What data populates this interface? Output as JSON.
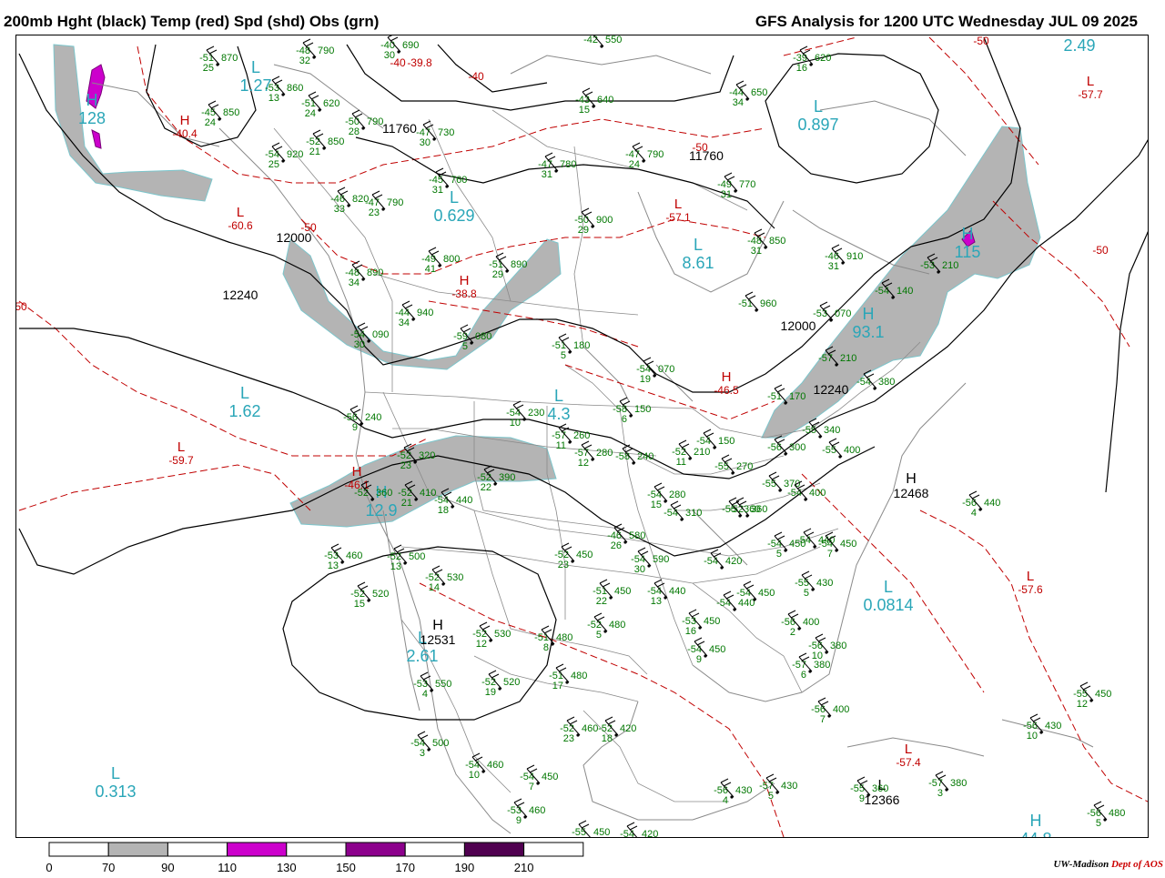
{
  "header": {
    "title_left": "200mb Hght (black) Temp (red) Spd (shd) Obs (grn)",
    "title_right": "GFS Analysis for 1200 UTC Wednesday  JUL 09 2025"
  },
  "credit": {
    "org": "UW-Madison",
    "dept": "Dept of AOS"
  },
  "colors": {
    "height_contour": "#000000",
    "temp_contour": "#c00000",
    "speed_70_90": "#b4b4b4",
    "speed_110_130": "#cc00cc",
    "speed_150_170": "#8c008c",
    "speed_190_210": "#500050",
    "obs": "#007700",
    "center_labels": "#2aa6b8",
    "political_lines": "#8a8a8a"
  },
  "legend": {
    "ticks": [
      "0",
      "70",
      "90",
      "110",
      "130",
      "150",
      "170",
      "190",
      "210"
    ],
    "fills": [
      "#ffffff",
      "#b4b4b4",
      "#ffffff",
      "#cc00cc",
      "#ffffff",
      "#8c008c",
      "#ffffff",
      "#500050",
      "#ffffff"
    ]
  },
  "height_labels": [
    "12000",
    "12240",
    "12000",
    "12240",
    "12468",
    "12531",
    "12366",
    "11760",
    "11760",
    "11760"
  ],
  "temp_labels": [
    "-40",
    "-40",
    "-50",
    "-50",
    "-50",
    "-60.6",
    "-40.4",
    "-38.8",
    "-39.8",
    "-46.5",
    "-46.1",
    "-59.7",
    "-57.6",
    "-57.4",
    "-57.1",
    "-57.7",
    "-50",
    "-50",
    "-50"
  ],
  "centers": [
    {
      "letter": "H",
      "color": "red",
      "value": "-40.4"
    },
    {
      "letter": "H",
      "color": "red",
      "value": "-38.8"
    },
    {
      "letter": "H",
      "color": "red",
      "value": "-46.5"
    },
    {
      "letter": "H",
      "color": "red",
      "value": "-46.1"
    },
    {
      "letter": "L",
      "color": "red",
      "value": "-60.6"
    },
    {
      "letter": "L",
      "color": "red",
      "value": "-59.7"
    },
    {
      "letter": "L",
      "color": "red",
      "value": "-57.6"
    },
    {
      "letter": "L",
      "color": "red",
      "value": "-57.4"
    },
    {
      "letter": "L",
      "color": "red",
      "value": "-57.1"
    },
    {
      "letter": "L",
      "color": "red",
      "value": "-57.7"
    },
    {
      "letter": "L",
      "color": "cyan",
      "value": "1.27"
    },
    {
      "letter": "L",
      "color": "cyan",
      "value": "0.629"
    },
    {
      "letter": "L",
      "color": "cyan",
      "value": "8.61"
    },
    {
      "letter": "L",
      "color": "cyan",
      "value": "0.897"
    },
    {
      "letter": "L",
      "color": "cyan",
      "value": "1.62"
    },
    {
      "letter": "L",
      "color": "cyan",
      "value": "2.61"
    },
    {
      "letter": "L",
      "color": "cyan",
      "value": "0.313"
    },
    {
      "letter": "L",
      "color": "cyan",
      "value": "0.0814"
    },
    {
      "letter": "H",
      "color": "cyan",
      "value": "2.49"
    },
    {
      "letter": "H",
      "color": "cyan",
      "value": "93.1"
    },
    {
      "letter": "H",
      "color": "cyan",
      "value": "115"
    },
    {
      "letter": "H",
      "color": "cyan",
      "value": "44.8"
    },
    {
      "letter": "H",
      "color": "cyan",
      "value": "12.9"
    },
    {
      "letter": "L",
      "color": "cyan",
      "value": "4.3"
    },
    {
      "letter": "H",
      "color": "cyan",
      "value": "128"
    },
    {
      "letter": "H",
      "color": "black",
      "value": "12468"
    },
    {
      "letter": "H",
      "color": "black",
      "value": "12531"
    },
    {
      "letter": "L",
      "color": "black",
      "value": "12366"
    }
  ],
  "obs": [
    {
      "t": "-51",
      "d": "25",
      "h": "870"
    },
    {
      "t": "-48",
      "d": "32",
      "h": "790"
    },
    {
      "t": "-40",
      "d": "30",
      "h": "690"
    },
    {
      "t": "-42",
      "d": "",
      "h": "550"
    },
    {
      "t": "-45",
      "d": "24",
      "h": "850"
    },
    {
      "t": "-53",
      "d": "13",
      "h": "860"
    },
    {
      "t": "-51",
      "d": "24",
      "h": "620"
    },
    {
      "t": "-50",
      "d": "28",
      "h": "790"
    },
    {
      "t": "-52",
      "d": "21",
      "h": "850"
    },
    {
      "t": "-54",
      "d": "25",
      "h": "920"
    },
    {
      "t": "-47",
      "d": "30",
      "h": "730"
    },
    {
      "t": "-44",
      "d": "34",
      "h": "650"
    },
    {
      "t": "-39",
      "d": "16",
      "h": "620"
    },
    {
      "t": "-43",
      "d": "15",
      "h": "640"
    },
    {
      "t": "-47",
      "d": "24",
      "h": "790"
    },
    {
      "t": "-47",
      "d": "31",
      "h": "780"
    },
    {
      "t": "-49",
      "d": "31",
      "h": "770"
    },
    {
      "t": "-45",
      "d": "31",
      "h": "760"
    },
    {
      "t": "-46",
      "d": "33",
      "h": "820"
    },
    {
      "t": "-47",
      "d": "23",
      "h": "790"
    },
    {
      "t": "-50",
      "d": "29",
      "h": "900"
    },
    {
      "t": "-48",
      "d": "31",
      "h": "850"
    },
    {
      "t": "-46",
      "d": "31",
      "h": "910"
    },
    {
      "t": "-49",
      "d": "41",
      "h": "800"
    },
    {
      "t": "-51",
      "d": "29",
      "h": "890"
    },
    {
      "t": "-48",
      "d": "34",
      "h": "890"
    },
    {
      "t": "-53",
      "d": "",
      "h": "210"
    },
    {
      "t": "-54",
      "d": "",
      "h": "140"
    },
    {
      "t": "-51",
      "d": "",
      "h": "960"
    },
    {
      "t": "-53",
      "d": "",
      "h": "070"
    },
    {
      "t": "-44",
      "d": "34",
      "h": "940"
    },
    {
      "t": "-54",
      "d": "30",
      "h": "090"
    },
    {
      "t": "-59",
      "d": "5",
      "h": "080"
    },
    {
      "t": "-51",
      "d": "5",
      "h": "180"
    },
    {
      "t": "-54",
      "d": "19",
      "h": "070"
    },
    {
      "t": "-57",
      "d": "",
      "h": "210"
    },
    {
      "t": "-54",
      "d": "",
      "h": "380"
    },
    {
      "t": "-51",
      "d": "",
      "h": "170"
    },
    {
      "t": "-56",
      "d": "9",
      "h": "240"
    },
    {
      "t": "-54",
      "d": "10",
      "h": "230"
    },
    {
      "t": "-58",
      "d": "6",
      "h": "150"
    },
    {
      "t": "-57",
      "d": "11",
      "h": "260"
    },
    {
      "t": "-55",
      "d": "",
      "h": "340"
    },
    {
      "t": "-52",
      "d": "23",
      "h": "320"
    },
    {
      "t": "-52",
      "d": "22",
      "h": "390"
    },
    {
      "t": "-57",
      "d": "12",
      "h": "280"
    },
    {
      "t": "-58",
      "d": "",
      "h": "240"
    },
    {
      "t": "-52",
      "d": "11",
      "h": "210"
    },
    {
      "t": "-54",
      "d": "",
      "h": "150"
    },
    {
      "t": "-55",
      "d": "",
      "h": "270"
    },
    {
      "t": "-56",
      "d": "",
      "h": "300"
    },
    {
      "t": "-55",
      "d": "",
      "h": "400"
    },
    {
      "t": "-52",
      "d": "",
      "h": "360"
    },
    {
      "t": "-52",
      "d": "21",
      "h": "410"
    },
    {
      "t": "-54",
      "d": "18",
      "h": "440"
    },
    {
      "t": "-55",
      "d": "",
      "h": "370"
    },
    {
      "t": "-54",
      "d": "",
      "h": "400"
    },
    {
      "t": "-52",
      "d": "",
      "h": "360"
    },
    {
      "t": "-54",
      "d": "15",
      "h": "280"
    },
    {
      "t": "-54",
      "d": "",
      "h": "310"
    },
    {
      "t": "-55",
      "d": "",
      "h": "360"
    },
    {
      "t": "-56",
      "d": "4",
      "h": "440"
    },
    {
      "t": "-46",
      "d": "26",
      "h": "580"
    },
    {
      "t": "-54",
      "d": "",
      "h": "440"
    },
    {
      "t": "-53",
      "d": "13",
      "h": "460"
    },
    {
      "t": "-52",
      "d": "13",
      "h": "500"
    },
    {
      "t": "-52",
      "d": "23",
      "h": "450"
    },
    {
      "t": "-54",
      "d": "30",
      "h": "590"
    },
    {
      "t": "-54",
      "d": "",
      "h": "420"
    },
    {
      "t": "-54",
      "d": "5",
      "h": "450"
    },
    {
      "t": "-54",
      "d": "7",
      "h": "450"
    },
    {
      "t": "-52",
      "d": "14",
      "h": "530"
    },
    {
      "t": "-52",
      "d": "15",
      "h": "520"
    },
    {
      "t": "-51",
      "d": "22",
      "h": "450"
    },
    {
      "t": "-54",
      "d": "13",
      "h": "440"
    },
    {
      "t": "-54",
      "d": "",
      "h": "440"
    },
    {
      "t": "-54",
      "d": "",
      "h": "450"
    },
    {
      "t": "-55",
      "d": "5",
      "h": "430"
    },
    {
      "t": "-52",
      "d": "12",
      "h": "530"
    },
    {
      "t": "-51",
      "d": "8",
      "h": "480"
    },
    {
      "t": "-52",
      "d": "5",
      "h": "480"
    },
    {
      "t": "-53",
      "d": "16",
      "h": "450"
    },
    {
      "t": "-56",
      "d": "2",
      "h": "400"
    },
    {
      "t": "-56",
      "d": "10",
      "h": "380"
    },
    {
      "t": "-54",
      "d": "9",
      "h": "450"
    },
    {
      "t": "-57",
      "d": "6",
      "h": "380"
    },
    {
      "t": "-53",
      "d": "4",
      "h": "550"
    },
    {
      "t": "-52",
      "d": "19",
      "h": "520"
    },
    {
      "t": "-51",
      "d": "17",
      "h": "480"
    },
    {
      "t": "-56",
      "d": "7",
      "h": "400"
    },
    {
      "t": "-52",
      "d": "23",
      "h": "460"
    },
    {
      "t": "-52",
      "d": "18",
      "h": "420"
    },
    {
      "t": "-55",
      "d": "12",
      "h": "450"
    },
    {
      "t": "-56",
      "d": "10",
      "h": "430"
    },
    {
      "t": "-54",
      "d": "3",
      "h": "500"
    },
    {
      "t": "-54",
      "d": "10",
      "h": "460"
    },
    {
      "t": "-54",
      "d": "7",
      "h": "450"
    },
    {
      "t": "-56",
      "d": "4",
      "h": "430"
    },
    {
      "t": "-57",
      "d": "5",
      "h": "430"
    },
    {
      "t": "-55",
      "d": "9",
      "h": "360"
    },
    {
      "t": "-57",
      "d": "3",
      "h": "380"
    },
    {
      "t": "-53",
      "d": "9",
      "h": "460"
    },
    {
      "t": "-55",
      "d": "",
      "h": "450"
    },
    {
      "t": "-54",
      "d": "",
      "h": "420"
    },
    {
      "t": "-56",
      "d": "5",
      "h": "480"
    }
  ]
}
